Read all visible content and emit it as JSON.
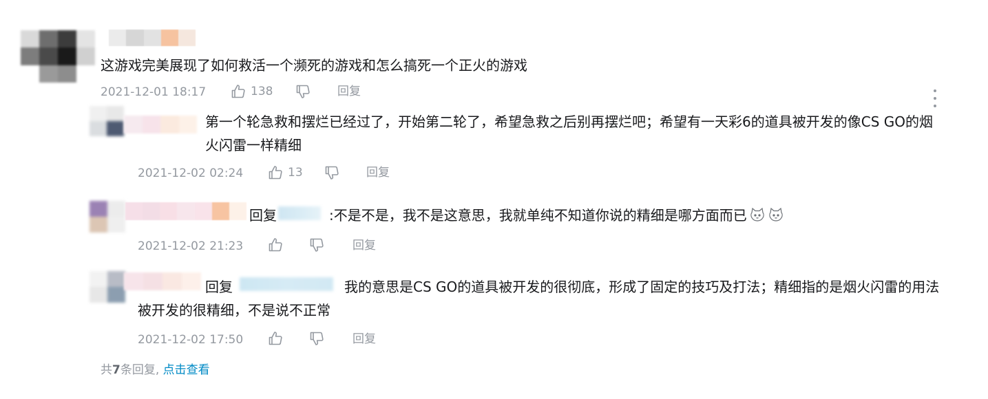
{
  "comment": {
    "text": "这游戏完美展现了如何救活一个濒死的游戏和怎么搞死一个正火的游戏",
    "time": "2021-12-01 18:17",
    "likes": "138",
    "reply_label": "回复"
  },
  "replies": [
    {
      "text": "第一个轮急救和摆烂已经过了，开始第二轮了，希望急救之后别再摆烂吧；希望有一天彩6的道具被开发的像CS GO的烟火闪雷一样精细",
      "time": "2021-12-02 02:24",
      "likes": "13",
      "reply_label": "回复"
    },
    {
      "reply_prefix": "回复",
      "text": ":不是不是，我不是这意思，我就单纯不知道你说的精细是哪方面而已",
      "emojis": [
        "cat-face-emoji",
        "cat-face-emoji"
      ],
      "time": "2021-12-02 21:23",
      "likes": "",
      "reply_label": "回复"
    },
    {
      "reply_prefix": "回复",
      "text": "我的意思是CS GO的道具被开发的很彻底，形成了固定的技巧及打法；精细指的是烟火闪雷的用法被开发的很精细，不是说不正常",
      "time": "2021-12-02 17:50",
      "likes": "",
      "reply_label": "回复"
    }
  ],
  "footer": {
    "prefix": "共",
    "count": "7",
    "suffix": "条回复,",
    "link": "点击查看"
  },
  "colors": {
    "text": "#18191c",
    "meta": "#9499a0",
    "link": "#008ac5",
    "background": "#ffffff"
  },
  "icons": [
    "thumbs-up-icon",
    "thumbs-down-icon",
    "more-vertical-icon"
  ]
}
